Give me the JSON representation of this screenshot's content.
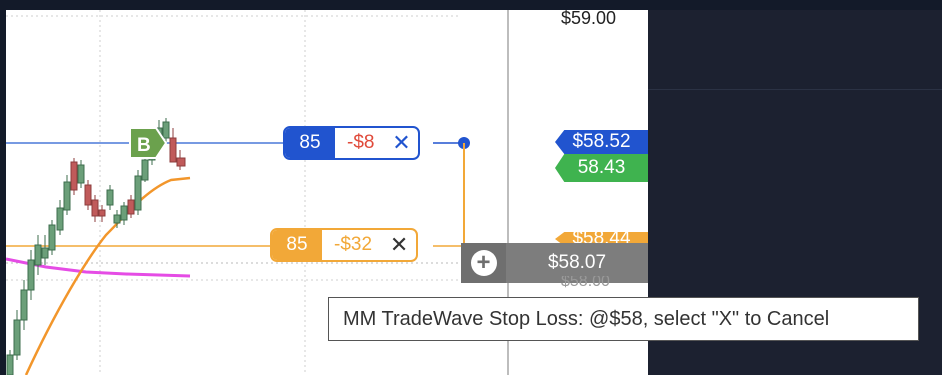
{
  "axis": {
    "top_price": "$59.00",
    "bottom_price": "$58.00"
  },
  "blue_order": {
    "qty": "85",
    "pnl": "-$8",
    "price_label": "$58.52"
  },
  "orange_order": {
    "qty": "85",
    "pnl": "-$32",
    "price_label": "$58.44"
  },
  "last_price_label": "58.43",
  "hover_price_label": "$58.07",
  "buy_marker": "B",
  "tooltip": "MM TradeWave Stop Loss: @$58, select \"X\" to Cancel",
  "colors": {
    "blue": "#2154cf",
    "orange": "#f2a838",
    "green": "#3fb34f",
    "magenta": "#e54ce5",
    "loss_red": "#e04a3a"
  },
  "icons": {
    "close": "close-icon",
    "crosshair": "plus-icon",
    "buy": "buy-marker-icon"
  }
}
